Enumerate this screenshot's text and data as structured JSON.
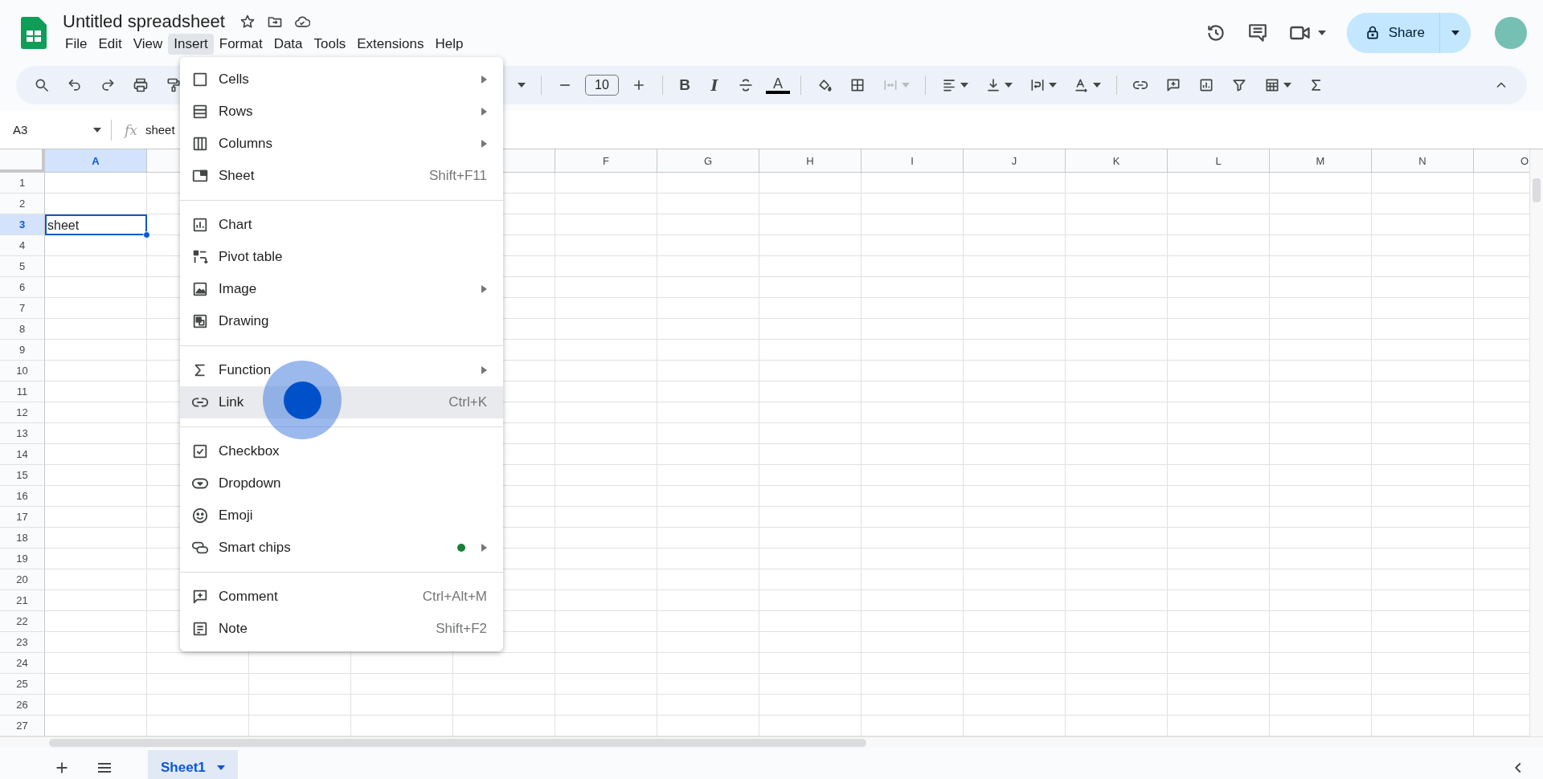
{
  "document": {
    "title": "Untitled spreadsheet"
  },
  "menubar": [
    {
      "label": "File",
      "selected": false
    },
    {
      "label": "Edit",
      "selected": false
    },
    {
      "label": "View",
      "selected": false
    },
    {
      "label": "Insert",
      "selected": true
    },
    {
      "label": "Format",
      "selected": false
    },
    {
      "label": "Data",
      "selected": false
    },
    {
      "label": "Tools",
      "selected": false
    },
    {
      "label": "Extensions",
      "selected": false
    },
    {
      "label": "Help",
      "selected": false
    }
  ],
  "share": {
    "label": "Share"
  },
  "toolbar": {
    "font_size": "10",
    "bold": "B",
    "italic": "I",
    "text_color": "A",
    "merge_disabled": true
  },
  "formula_bar": {
    "cell_ref": "A3",
    "fx": "fx",
    "value": "sheet"
  },
  "columns": [
    {
      "label": "A",
      "selected": true
    },
    {
      "selected": false
    },
    {},
    {},
    {
      "selected": false
    },
    {
      "label": "F",
      "selected": false
    },
    {
      "label": "G",
      "selected": false
    },
    {
      "label": "H",
      "selected": false
    },
    {
      "label": "I",
      "selected": false
    },
    {
      "label": "J",
      "selected": false
    },
    {
      "label": "K",
      "selected": false
    },
    {
      "label": "L",
      "selected": false
    },
    {
      "label": "M",
      "selected": false
    },
    {
      "label": "N",
      "selected": false
    },
    {
      "label": "O",
      "selected": false
    }
  ],
  "rows": [
    {
      "label": "1",
      "selected": false
    },
    {
      "label": "2",
      "selected": false
    },
    {
      "label": "3",
      "selected": true,
      "cells": [
        {
          "value": "sheet",
          "selected": true
        }
      ]
    },
    {
      "label": "4",
      "selected": false
    },
    {
      "label": "5",
      "selected": false
    },
    {
      "label": "6",
      "selected": false
    },
    {
      "label": "7",
      "selected": false
    },
    {
      "label": "8",
      "selected": false
    },
    {
      "label": "9",
      "selected": false
    },
    {
      "label": "10",
      "selected": false
    },
    {
      "label": "11",
      "selected": false
    },
    {
      "label": "12",
      "selected": false
    },
    {
      "label": "13",
      "selected": false
    },
    {
      "label": "14",
      "selected": false
    },
    {
      "label": "15",
      "selected": false
    },
    {
      "label": "16",
      "selected": false
    },
    {
      "label": "17",
      "selected": false
    },
    {
      "label": "18",
      "selected": false
    },
    {
      "label": "19",
      "selected": false
    },
    {
      "label": "20",
      "selected": false
    },
    {
      "label": "21",
      "selected": false
    },
    {
      "label": "22",
      "selected": false
    },
    {
      "label": "23",
      "selected": false
    },
    {
      "label": "24",
      "selected": false
    },
    {
      "label": "25",
      "selected": false
    },
    {
      "label": "26",
      "selected": false
    },
    {
      "label": "27",
      "selected": false
    }
  ],
  "insert_menu": {
    "groups": [
      [
        {
          "label": "Cells",
          "submenu": true,
          "highlighted": false
        },
        {
          "label": "Rows",
          "submenu": true,
          "highlighted": false
        },
        {
          "label": "Columns",
          "submenu": true,
          "highlighted": false
        },
        {
          "label": "Sheet",
          "shortcut": "Shift+F11",
          "submenu": false,
          "highlighted": false
        }
      ],
      [
        {
          "label": "Chart",
          "submenu": false,
          "highlighted": false
        },
        {
          "label": "Pivot table",
          "submenu": false,
          "highlighted": false
        },
        {
          "label": "Image",
          "submenu": true,
          "highlighted": false
        },
        {
          "label": "Drawing",
          "submenu": false,
          "highlighted": false
        }
      ],
      [
        {
          "label": "Function",
          "submenu": true,
          "highlighted": false
        },
        {
          "label": "Link",
          "shortcut": "Ctrl+K",
          "submenu": false,
          "highlighted": true
        }
      ],
      [
        {
          "label": "Checkbox",
          "submenu": false,
          "highlighted": false
        },
        {
          "label": "Dropdown",
          "submenu": false,
          "highlighted": false
        },
        {
          "label": "Emoji",
          "submenu": false,
          "highlighted": false
        },
        {
          "label": "Smart chips",
          "submenu": true,
          "highlighted": false,
          "color": "#188038"
        }
      ],
      [
        {
          "label": "Comment",
          "shortcut": "Ctrl+Alt+M",
          "submenu": false,
          "highlighted": false
        },
        {
          "label": "Note",
          "shortcut": "Shift+F2",
          "submenu": false,
          "highlighted": false
        }
      ]
    ]
  },
  "sheet_tabs": [
    {
      "label": "Sheet1",
      "selected": true
    }
  ]
}
